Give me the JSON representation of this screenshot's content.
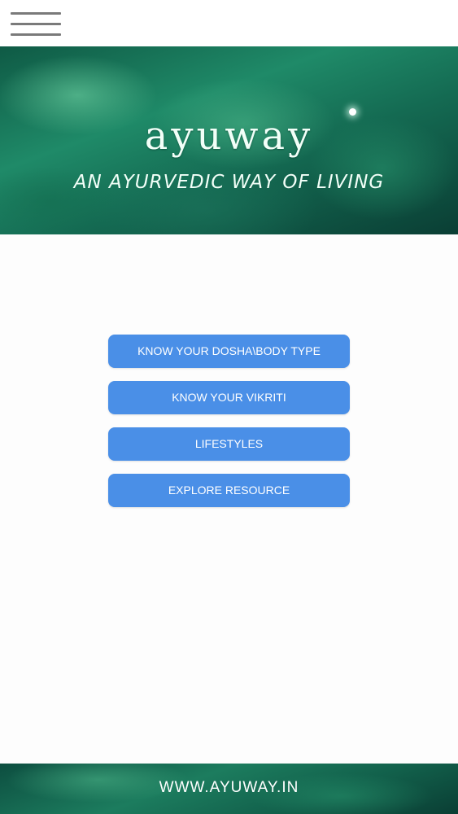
{
  "header": {
    "menu_icon": "hamburger-menu-icon"
  },
  "banner": {
    "logo_text": "ayuway",
    "tagline": "AN AYURVEDIC WAY OF LIVING"
  },
  "menu": {
    "items": [
      {
        "label": "KNOW YOUR DOSHA\\BODY TYPE"
      },
      {
        "label": "KNOW YOUR VIKRITI"
      },
      {
        "label": "LIFESTYLES"
      },
      {
        "label": "EXPLORE RESOURCE"
      }
    ]
  },
  "footer": {
    "link_text": "WWW.AYUWAY.IN"
  },
  "colors": {
    "button": "#4a8fe7",
    "button_text": "#ffffff",
    "banner_green": "#1f8a68",
    "hamburger": "#7a7a7a"
  }
}
